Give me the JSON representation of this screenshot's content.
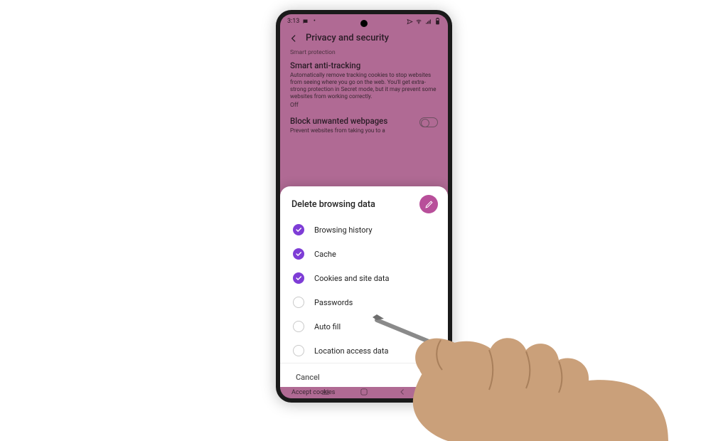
{
  "statusbar": {
    "time": "3:13",
    "icons_left": [
      "message-icon",
      "more-icon"
    ],
    "icons_right": [
      "send-icon",
      "wifi-icon",
      "signal-icon",
      "battery-icon"
    ]
  },
  "header": {
    "title": "Privacy and security"
  },
  "smart_protection": {
    "section_label": "Smart protection",
    "anti_tracking": {
      "title": "Smart anti-tracking",
      "desc": "Automatically remove tracking cookies to stop websites from seeing where you go on the web. You'll get extra-strong protection in Secret mode, but it may prevent some websites from working correctly.",
      "state": "Off"
    },
    "block_unwanted": {
      "title": "Block unwanted webpages",
      "desc": "Prevent websites from taking you to a"
    }
  },
  "sheet": {
    "title": "Delete browsing data",
    "edit_icon": "pencil-icon",
    "options": [
      {
        "label": "Browsing history",
        "checked": true
      },
      {
        "label": "Cache",
        "checked": true
      },
      {
        "label": "Cookies and site data",
        "checked": true
      },
      {
        "label": "Passwords",
        "checked": false
      },
      {
        "label": "Auto fill",
        "checked": false
      },
      {
        "label": "Location access data",
        "checked": false
      }
    ],
    "cancel": "Cancel"
  },
  "peek_row": "Accept cookies",
  "colors": {
    "accent": "#7e3dd6",
    "fab": "#b84f9a",
    "bg": "#b06a94"
  }
}
